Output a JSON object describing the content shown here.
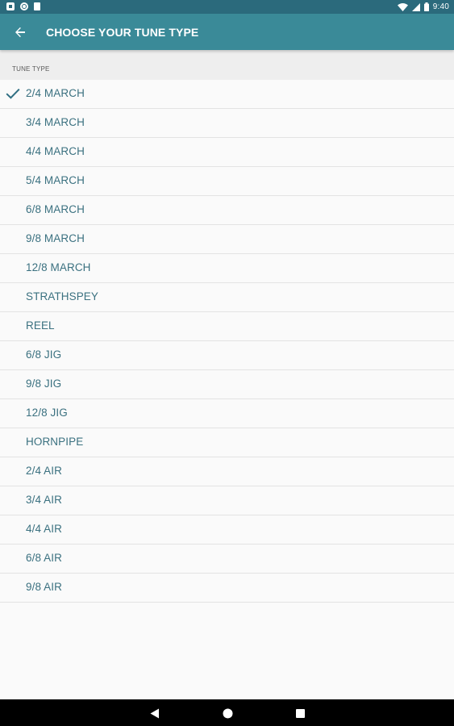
{
  "status_bar": {
    "time": "9:40",
    "left_icons": [
      "notification-square-icon",
      "notification-circle-icon",
      "sd-card-icon"
    ],
    "right_icons": [
      "wifi-icon",
      "signal-icon",
      "battery-icon"
    ]
  },
  "app_bar": {
    "back_icon": "arrow-left-icon",
    "title": "CHOOSE YOUR TUNE TYPE"
  },
  "section": {
    "label": "TUNE TYPE"
  },
  "tune_types": [
    {
      "label": "2/4 MARCH",
      "selected": true
    },
    {
      "label": "3/4 MARCH",
      "selected": false
    },
    {
      "label": "4/4 MARCH",
      "selected": false
    },
    {
      "label": "5/4 MARCH",
      "selected": false
    },
    {
      "label": "6/8 MARCH",
      "selected": false
    },
    {
      "label": "9/8 MARCH",
      "selected": false
    },
    {
      "label": "12/8 MARCH",
      "selected": false
    },
    {
      "label": "STRATHSPEY",
      "selected": false
    },
    {
      "label": "REEL",
      "selected": false
    },
    {
      "label": "6/8 JIG",
      "selected": false
    },
    {
      "label": "9/8 JIG",
      "selected": false
    },
    {
      "label": "12/8 JIG",
      "selected": false
    },
    {
      "label": "HORNPIPE",
      "selected": false
    },
    {
      "label": "2/4 AIR",
      "selected": false
    },
    {
      "label": "3/4 AIR",
      "selected": false
    },
    {
      "label": "4/4 AIR",
      "selected": false
    },
    {
      "label": "6/8 AIR",
      "selected": false
    },
    {
      "label": "9/8 AIR",
      "selected": false
    }
  ],
  "nav_bar": {
    "buttons": [
      "back-triangle-icon",
      "home-circle-icon",
      "recents-square-icon"
    ]
  },
  "colors": {
    "status_bar": "#2b6a7c",
    "app_bar": "#3a8a98",
    "item_text": "#3b7180",
    "check": "#2f6e82",
    "section_bg": "#eeeeee",
    "background": "#fafafa"
  }
}
